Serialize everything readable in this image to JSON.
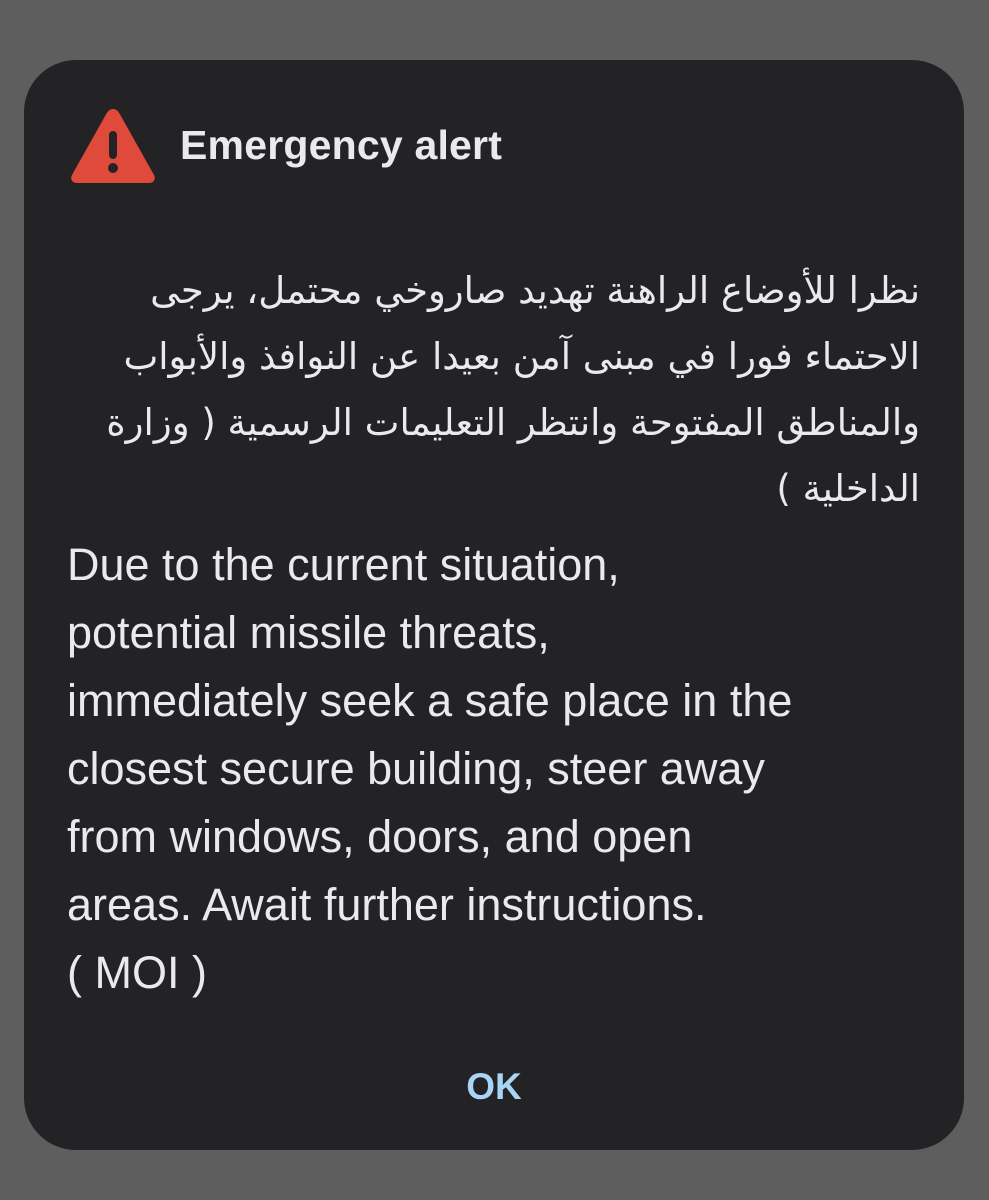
{
  "alert": {
    "title": "Emergency alert",
    "icon": "warning-triangle-icon",
    "icon_color": "#e04a3b",
    "arabic_message": "نظرا للأوضاع الراهنة تهديد صاروخي محتمل، يرجى الاحتماء فورا في مبنى آمن بعيدا عن النوافذ والأبواب والمناطق المفتوحة وانتظر التعليمات الرسمية ( وزارة الداخلية )",
    "english_lines": [
      "Due to the current situation,",
      "potential missile threats,",
      "immediately seek a safe place in the",
      "closest secure building, steer away",
      "from windows, doors, and open",
      "areas. Await further instructions.",
      "( MOI  )"
    ],
    "ok_label": "OK",
    "accent_color": "#a8d4f5"
  }
}
